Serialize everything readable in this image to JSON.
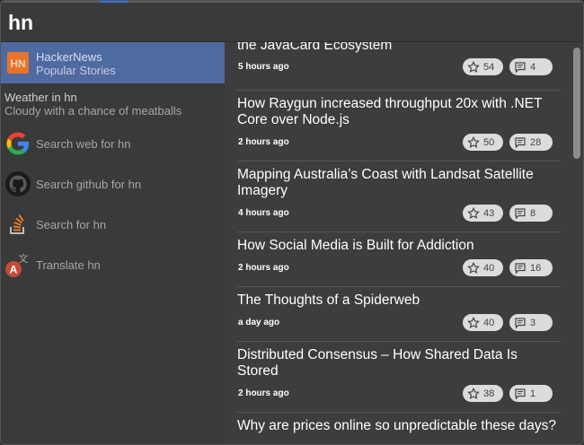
{
  "search": {
    "query": "hn"
  },
  "sidebar": {
    "items": [
      {
        "icon": "hackernews-icon",
        "title": "HackerNews",
        "subtitle": "Popular Stories",
        "active": true
      },
      {
        "icon": "",
        "title": "Weather in hn",
        "subtitle": "Cloudy with a chance of meatballs"
      },
      {
        "icon": "google-icon",
        "title": "Search web for hn"
      },
      {
        "icon": "github-icon",
        "title": "Search github for hn"
      },
      {
        "icon": "stackoverflow-icon",
        "title": "Search for hn"
      },
      {
        "icon": "translate-icon",
        "title": "Translate hn"
      }
    ],
    "hn_badge": "HN"
  },
  "stories": [
    {
      "title": "the JavaCard Ecosystem",
      "time": "5 hours ago",
      "points": "54",
      "comments": "4"
    },
    {
      "title": "How Raygun increased throughput 20x with .NET Core over Node.js",
      "time": "2 hours ago",
      "points": "50",
      "comments": "28"
    },
    {
      "title": "Mapping Australia’s Coast with Landsat Satellite Imagery",
      "time": "4 hours ago",
      "points": "43",
      "comments": "8"
    },
    {
      "title": "How Social Media is Built for Addiction",
      "time": "2 hours ago",
      "points": "40",
      "comments": "16"
    },
    {
      "title": "The Thoughts of a Spiderweb",
      "time": "a day ago",
      "points": "40",
      "comments": "3"
    },
    {
      "title": "Distributed Consensus – How Shared Data Is Stored",
      "time": "2 hours ago",
      "points": "38",
      "comments": "1"
    },
    {
      "title": "Why are prices online so unpredictable these days?",
      "time": "",
      "points": "",
      "comments": ""
    }
  ],
  "colors": {
    "active_bg": "#4f6aa0",
    "hn_orange": "#e8732a",
    "list_bg": "#3d3d3e"
  }
}
